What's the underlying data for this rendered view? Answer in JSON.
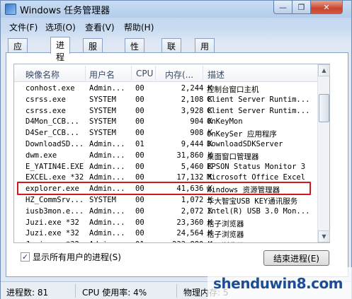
{
  "window": {
    "title": "Windows 任务管理器"
  },
  "menu": [
    "文件(F)",
    "选项(O)",
    "查看(V)",
    "帮助(H)"
  ],
  "tabs": [
    {
      "label": "应用程序",
      "active": false
    },
    {
      "label": "进程",
      "active": true
    },
    {
      "label": "服务",
      "active": false
    },
    {
      "label": "性能",
      "active": false
    },
    {
      "label": "联网",
      "active": false
    },
    {
      "label": "用户",
      "active": false
    }
  ],
  "columns": {
    "name": "映像名称",
    "user": "用户名",
    "cpu": "CPU",
    "mem": "内存(...",
    "desc": "描述"
  },
  "processes": [
    {
      "name": "conhost.exe",
      "user": "Admin...",
      "cpu": "00",
      "mem": "2,244 K",
      "desc": "控制台窗口主机"
    },
    {
      "name": "csrss.exe",
      "user": "SYSTEM",
      "cpu": "00",
      "mem": "2,108 K",
      "desc": "Client Server Runtim..."
    },
    {
      "name": "csrss.exe",
      "user": "SYSTEM",
      "cpu": "00",
      "mem": "3,928 K",
      "desc": "Client Server Runtim..."
    },
    {
      "name": "D4Mon_CCB...",
      "user": "SYSTEM",
      "cpu": "00",
      "mem": "904 K",
      "desc": "OnKeyMon"
    },
    {
      "name": "D4Ser_CCB...",
      "user": "SYSTEM",
      "cpu": "00",
      "mem": "908 K",
      "desc": "OnKeySer 应用程序"
    },
    {
      "name": "DownloadSD...",
      "user": "Admin...",
      "cpu": "01",
      "mem": "9,444 K",
      "desc": "DownloadSDKServer"
    },
    {
      "name": "dwm.exe",
      "user": "Admin...",
      "cpu": "00",
      "mem": "31,860 K",
      "desc": "桌面窗口管理器"
    },
    {
      "name": "E_YATIN4E.EXE",
      "user": "Admin...",
      "cpu": "00",
      "mem": "5,460 K",
      "desc": "EPSON Status Monitor 3"
    },
    {
      "name": "EXCEL.exe *32",
      "user": "Admin...",
      "cpu": "00",
      "mem": "17,132 K",
      "desc": "Microsoft Office Excel"
    },
    {
      "name": "explorer.exe",
      "user": "Admin...",
      "cpu": "00",
      "mem": "41,636 K",
      "desc": "Windows 资源管理器"
    },
    {
      "name": "HZ_CommSrv...",
      "user": "SYSTEM",
      "cpu": "00",
      "mem": "1,072 K",
      "desc": "华大智宝USB KEY通讯服务"
    },
    {
      "name": "iusb3mon.e...",
      "user": "Admin...",
      "cpu": "00",
      "mem": "2,072 K",
      "desc": "Intel(R) USB 3.0 Mon..."
    },
    {
      "name": "Juzi.exe *32",
      "user": "Admin...",
      "cpu": "00",
      "mem": "23,360 K",
      "desc": "桔子浏览器"
    },
    {
      "name": "Juzi.exe *32",
      "user": "Admin...",
      "cpu": "00",
      "mem": "24,564 K",
      "desc": "桔子浏览器"
    },
    {
      "name": "Juzi.exe *32",
      "user": "Admin...",
      "cpu": "01",
      "mem": "233,880 K",
      "desc": "桔子浏览器"
    }
  ],
  "show_all_users": {
    "label": "显示所有用户的进程(S)",
    "checked": true,
    "mark": "✓"
  },
  "end_process_button": "结束进程(E)",
  "status": {
    "processes": "进程数: 81",
    "cpu": "CPU 使用率: 4%",
    "memory": "物理内存: 5"
  },
  "watermark": "shenduwin8.com",
  "icons": {
    "close": "✕",
    "min": "—",
    "max": "❐",
    "up": "▲",
    "down": "▼"
  },
  "highlight_color": "#d0191c"
}
